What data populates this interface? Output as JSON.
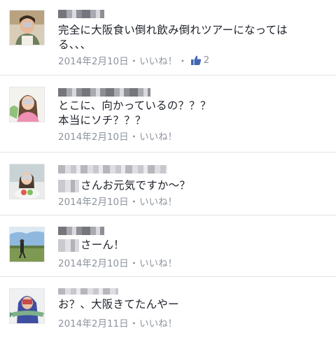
{
  "comments": [
    {
      "text_line1": "完全に大阪食い倒れ飲み倒れツアーになっては",
      "text_line2": "る、、、",
      "date": "2014年2月10日",
      "separator": "・",
      "like_label": "いいね！",
      "like_separator": "・",
      "like_count": "2"
    },
    {
      "text_line1": "とこに、向かっているの？？？",
      "text_line2": "本当にソチ？？？",
      "date": "2014年2月10日",
      "separator": "・",
      "like_label": "いいね！"
    },
    {
      "text": "さんお元気ですか〜？",
      "date": "2014年2月10日",
      "separator": "・",
      "like_label": "いいね！"
    },
    {
      "text": "さーん！",
      "date": "2014年2月10日",
      "separator": "・",
      "like_label": "いいね！"
    },
    {
      "text": "お？、大阪きてたんやー",
      "date": "2014年2月11日",
      "separator": "・",
      "like_label": "いいね！"
    }
  ],
  "colors": {
    "text": "#1d2129",
    "meta": "#8d949e",
    "like_thumb": "#4267b2",
    "divider": "#e3e4e8"
  }
}
